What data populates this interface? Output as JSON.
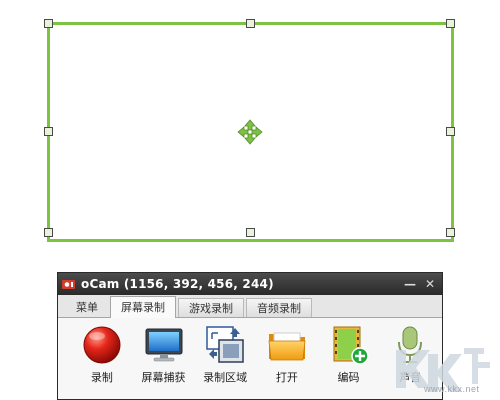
{
  "capture": {
    "border_color": "#7dc242"
  },
  "window": {
    "title": "oCam (1156, 392, 456, 244)",
    "buttons": {
      "minimize": "—",
      "close": "✕"
    }
  },
  "tabs": [
    {
      "label": "菜单",
      "active": false
    },
    {
      "label": "屏幕录制",
      "active": true
    },
    {
      "label": "游戏录制",
      "active": false
    },
    {
      "label": "音频录制",
      "active": false
    }
  ],
  "tools": [
    {
      "label": "录制",
      "icon": "record-icon"
    },
    {
      "label": "屏幕捕获",
      "icon": "monitor-icon"
    },
    {
      "label": "录制区域",
      "icon": "region-icon"
    },
    {
      "label": "打开",
      "icon": "folder-icon"
    },
    {
      "label": "编码",
      "icon": "codec-icon"
    },
    {
      "label": "声音",
      "icon": "microphone-icon"
    }
  ],
  "watermark": {
    "text": "www.kkx.net",
    "logo": "kk-download-logo"
  }
}
